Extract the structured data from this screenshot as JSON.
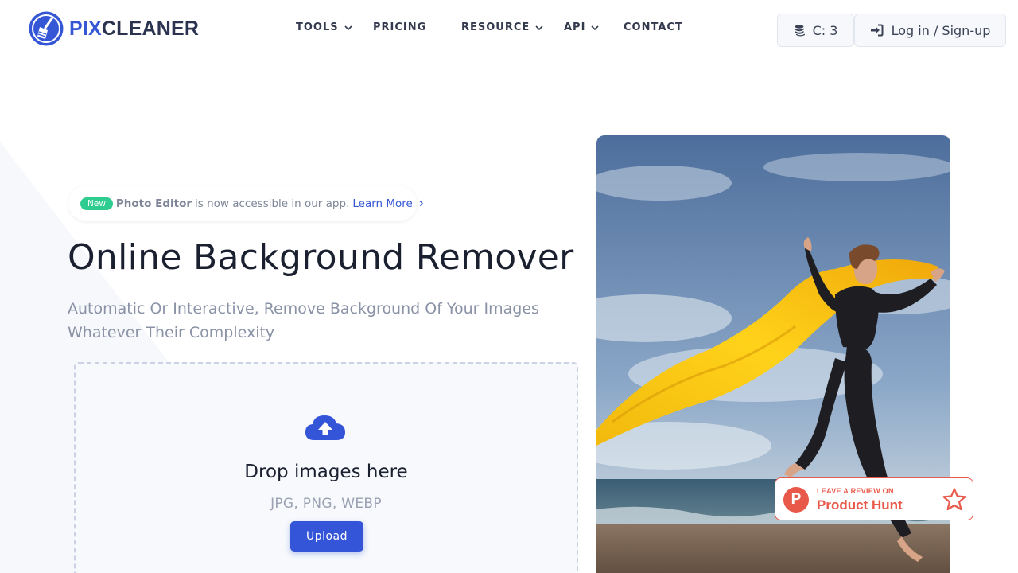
{
  "brand": {
    "name_part1": "PIX",
    "name_part2": "CLEANER"
  },
  "nav": {
    "items": [
      {
        "label": "TOOLS",
        "dropdown": true
      },
      {
        "label": "PRICING",
        "dropdown": false
      },
      {
        "label": "RESOURCE",
        "dropdown": true
      },
      {
        "label": "API",
        "dropdown": true
      },
      {
        "label": "CONTACT",
        "dropdown": false
      }
    ]
  },
  "header": {
    "credits_label": "C: 3",
    "login_label": "Log in / Sign-up"
  },
  "announcement": {
    "badge": "New",
    "feature": "Photo Editor",
    "text": "is now accessible in our app.",
    "link": "Learn More"
  },
  "hero": {
    "title": "Online Background Remover",
    "subtitle": "Automatic Or Interactive, Remove Background Of Your Images Whatever Their Complexity"
  },
  "dropzone": {
    "title": "Drop images here",
    "formats": "JPG, PNG, WEBP",
    "upload_label": "Upload"
  },
  "product_hunt": {
    "small": "LEAVE A REVIEW ON",
    "big": "Product Hunt",
    "letter": "P"
  },
  "colors": {
    "accent": "#3455d8",
    "new_badge": "#2ecc8f",
    "product_hunt": "#e9594a"
  }
}
